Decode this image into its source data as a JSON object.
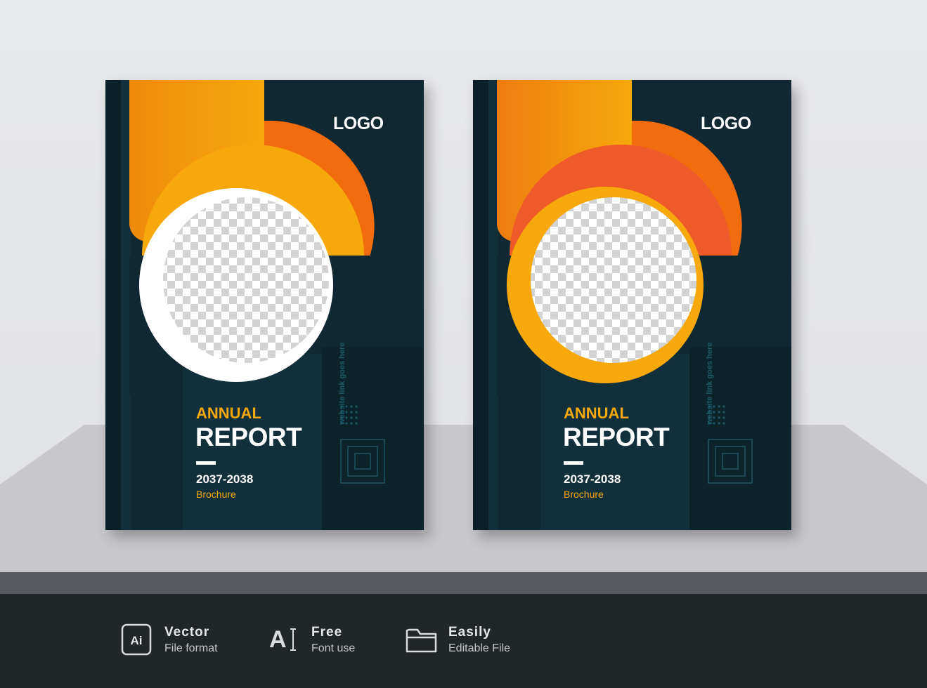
{
  "covers": [
    {
      "logo": "LOGO",
      "title_line1": "ANNUAL",
      "title_line2": "REPORT",
      "years": "2037-2038",
      "subtitle": "Brochure",
      "website": "website link goes here"
    },
    {
      "logo": "LOGO",
      "title_line1": "ANNUAL",
      "title_line2": "REPORT",
      "years": "2037-2038",
      "subtitle": "Brochure",
      "website": "website link goes here"
    }
  ],
  "features": [
    {
      "icon": "ai-file-icon",
      "title": "Vector",
      "subtitle": "File format"
    },
    {
      "icon": "font-icon",
      "title": "Free",
      "subtitle": "Font use"
    },
    {
      "icon": "folder-icon",
      "title": "Easily",
      "subtitle": "Editable File"
    }
  ],
  "colors": {
    "navy": "#0f2832",
    "orange": "#f7a80b",
    "deep_orange": "#f26b0d",
    "red_orange": "#ef5a2a",
    "footer": "#212628"
  }
}
